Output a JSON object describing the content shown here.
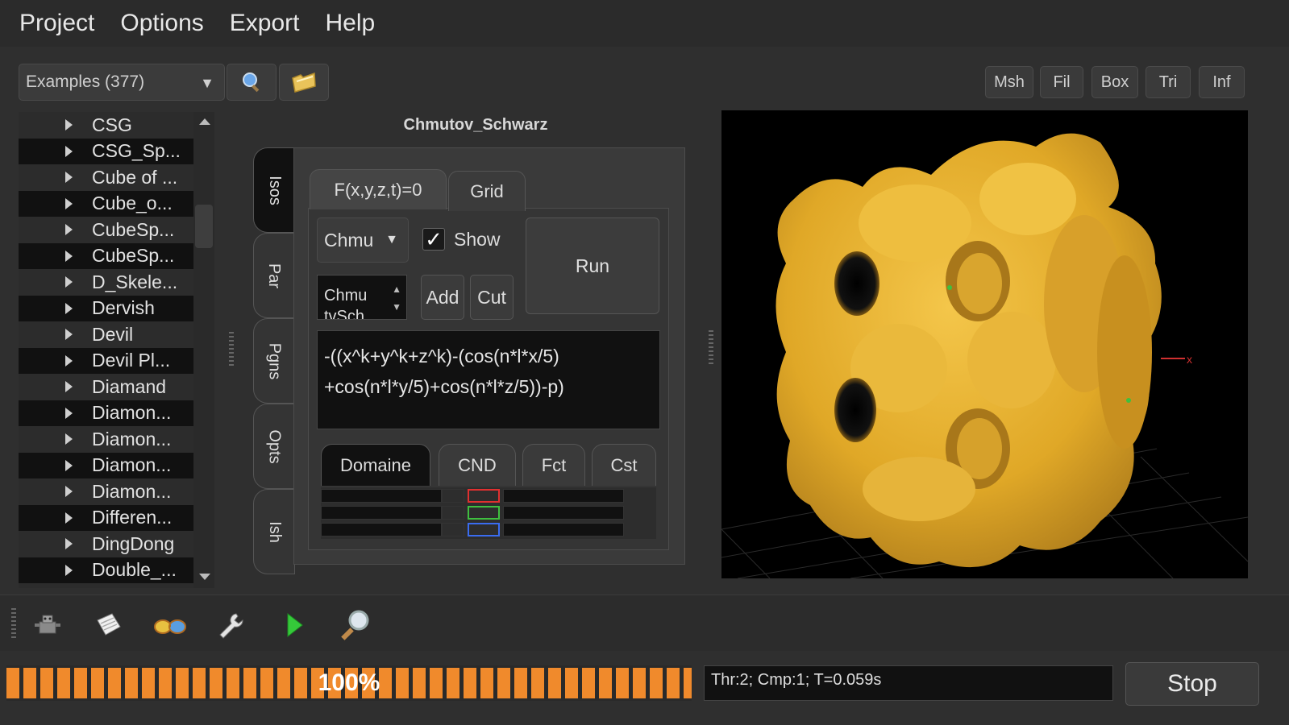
{
  "menu": {
    "items": [
      "Project",
      "Options",
      "Export",
      "Help"
    ]
  },
  "toolbar": {
    "examples_label": "Examples (377)",
    "view_buttons": [
      "Msh",
      "Fil",
      "Box",
      "Tri",
      "Inf"
    ]
  },
  "tree": {
    "items": [
      "CSG",
      "CSG_Sp...",
      "Cube of ...",
      "Cube_o...",
      "CubeSp...",
      "CubeSp...",
      "D_Skele...",
      "Dervish",
      "Devil",
      "Devil Pl...",
      "Diamand",
      "Diamon...",
      "Diamon...",
      "Diamon...",
      "Diamon...",
      "Differen...",
      "DingDong",
      "Double_..."
    ]
  },
  "editor": {
    "model_name": "Chmutov_Schwarz",
    "side_tabs": [
      "Isos",
      "Par",
      "Pgns",
      "Opts",
      "Ish"
    ],
    "top_tabs": [
      "F(x,y,z,t)=0",
      "Grid"
    ],
    "function_combo": "Chmu",
    "show_label": "Show",
    "show_checked": "✓",
    "run_label": "Run",
    "spin_value": "Chmu tvSch",
    "add_label": "Add",
    "cut_label": "Cut",
    "formula_line1": "-((x^k+y^k+z^k)-(cos(n*l*x/5)",
    "formula_line2": "+cos(n*l*y/5)+cos(n*l*z/5))-p)",
    "bottom_tabs": [
      "Domaine",
      "CND",
      "Fct",
      "Cst"
    ]
  },
  "bottom_toolbar": {
    "icons": [
      "robot-icon",
      "notepad-icon",
      "glasses-icon",
      "wrench-icon",
      "play-icon",
      "magnifier-icon"
    ]
  },
  "status": {
    "progress": 100,
    "progress_label": "100%",
    "info": "Thr:2; Cmp:1; T=0.059s",
    "stop_label": "Stop"
  },
  "colors": {
    "accent": "#f08a2c",
    "surface": "#e4ab2b",
    "background": "#2f2f2f"
  }
}
